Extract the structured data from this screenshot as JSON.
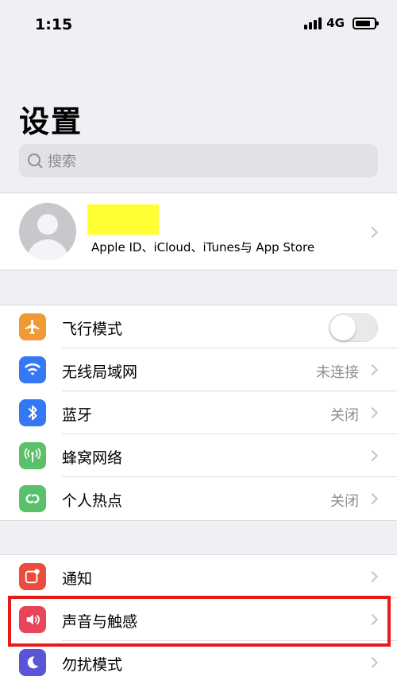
{
  "status_bar": {
    "time": "1:15",
    "network": "4G"
  },
  "page": {
    "title": "设置"
  },
  "search": {
    "placeholder": "搜索"
  },
  "profile": {
    "subtitle": "Apple ID、iCloud、iTunes与 App Store"
  },
  "connectivity": [
    {
      "label": "飞行模式",
      "icon": "airplane-icon",
      "color": "#f09a37",
      "toggle": false
    },
    {
      "label": "无线局域网",
      "icon": "wifi-icon",
      "color": "#3478f6",
      "value": "未连接"
    },
    {
      "label": "蓝牙",
      "icon": "bluetooth-icon",
      "color": "#3478f6",
      "value": "关闭"
    },
    {
      "label": "蜂窝网络",
      "icon": "antenna-icon",
      "color": "#5ac06a"
    },
    {
      "label": "个人热点",
      "icon": "hotspot-icon",
      "color": "#5ac06a",
      "value": "关闭"
    }
  ],
  "notifications_group": [
    {
      "label": "通知",
      "icon": "notification-icon",
      "color": "#ea4d3d"
    },
    {
      "label": "声音与触感",
      "icon": "speaker-icon",
      "color": "#e9455a"
    },
    {
      "label": "勿扰模式",
      "icon": "moon-icon",
      "color": "#5a55d6"
    }
  ],
  "highlight_color": "#e8191b"
}
